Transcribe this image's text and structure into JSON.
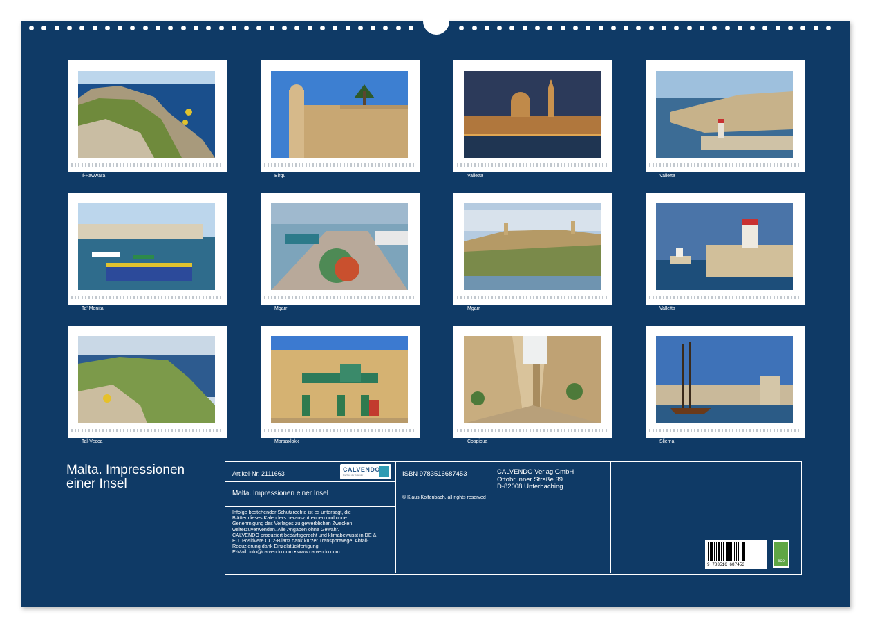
{
  "colors": {
    "cover_background": "#0f3a66",
    "frame": "#ffffff"
  },
  "thumbnails": [
    {
      "caption": "Il-Fawwara"
    },
    {
      "caption": "Birgu"
    },
    {
      "caption": "Valletta"
    },
    {
      "caption": "Valletta"
    },
    {
      "caption": "Ta' Monita"
    },
    {
      "caption": "Mgarr"
    },
    {
      "caption": "Mgarr"
    },
    {
      "caption": "Valletta"
    },
    {
      "caption": "Tal-Vecca"
    },
    {
      "caption": "Marsaxlokk"
    },
    {
      "caption": "Cospicua"
    },
    {
      "caption": "Sliema"
    }
  ],
  "calendar_title_line1": "Malta. Impressionen",
  "calendar_title_line2": "einer Insel",
  "info": {
    "article_number": "Artikel-Nr. 2111663",
    "logo_text": "CALVENDO",
    "logo_subtext": "Die Welt der Kalender",
    "calendar_name": "Malta. Impressionen einer Insel",
    "legal_lines": [
      "Infolge bestehender Schutzrechte ist es untersagt, die",
      "Blätter dieses Kalenders herauszutrennen und ohne",
      "Genehmigung des Verlages zu gewerblichen Zwecken",
      "weiterzuverwenden. Alle Angaben ohne Gewähr.",
      "CALVENDO produziert bedarfsgerecht und klimabewusst in DE &",
      "EU. Positivere CO2-Bilanz dank kurzer Transportwege. Abfall-",
      "Reduzierung dank Einzelstückfertigung.",
      "E-Mail: info@calvendo.com • www.calvendo.com"
    ],
    "isbn": "ISBN 9783516687453",
    "publisher_lines": [
      "CALVENDO Verlag GmbH",
      "Ottobrunner Straße 39",
      "D-82008 Unterhaching"
    ],
    "copyright": "© Klaus Kolfenbach, all rights reserved",
    "barcode_number": "9 783516 687453",
    "eco_label": "eco"
  }
}
